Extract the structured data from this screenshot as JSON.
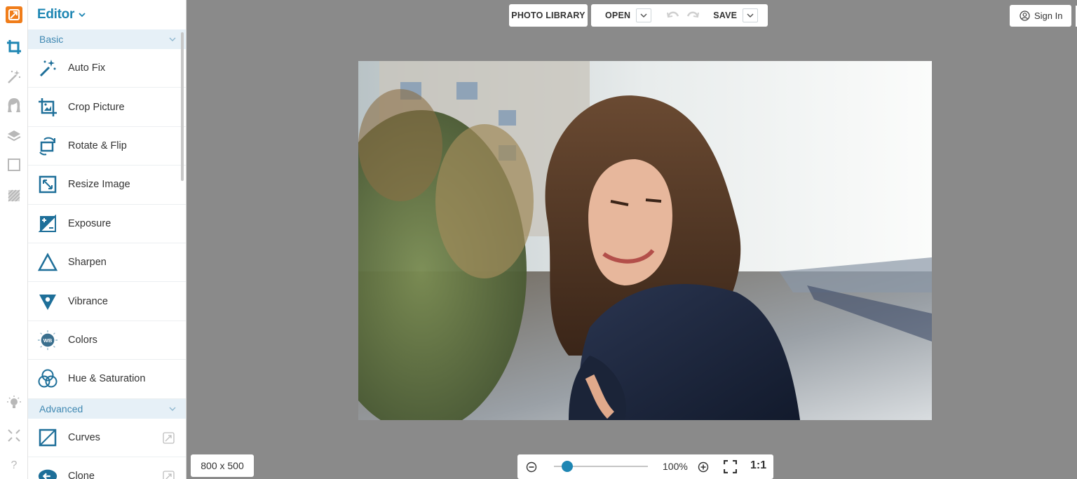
{
  "app": {
    "brand_color": "#f07d1a",
    "accent_color": "#1e86b3"
  },
  "rail": {
    "icons": [
      "crop-icon",
      "magic-wand-icon",
      "portrait-icon",
      "layers-icon",
      "frame-icon",
      "texture-icon",
      "lightbulb-icon",
      "fullscreen-icon",
      "help-icon"
    ],
    "help_label": "?"
  },
  "panel": {
    "title": "Editor",
    "sections": [
      {
        "label": "Basic",
        "tools": [
          {
            "label": "Auto Fix",
            "icon": "auto-fix-icon"
          },
          {
            "label": "Crop Picture",
            "icon": "crop-picture-icon"
          },
          {
            "label": "Rotate & Flip",
            "icon": "rotate-flip-icon"
          },
          {
            "label": "Resize Image",
            "icon": "resize-icon"
          },
          {
            "label": "Exposure",
            "icon": "exposure-icon"
          },
          {
            "label": "Sharpen",
            "icon": "sharpen-icon"
          },
          {
            "label": "Vibrance",
            "icon": "vibrance-icon"
          },
          {
            "label": "Colors",
            "icon": "white-balance-icon",
            "icon_text": "WB"
          },
          {
            "label": "Hue & Saturation",
            "icon": "hue-saturation-icon"
          }
        ]
      },
      {
        "label": "Advanced",
        "tools": [
          {
            "label": "Curves",
            "icon": "curves-icon",
            "pro": true
          },
          {
            "label": "Clone",
            "icon": "clone-icon",
            "pro": true
          }
        ]
      }
    ]
  },
  "topbar": {
    "photo_library": "PHOTO LIBRARY",
    "open": "OPEN",
    "save": "SAVE",
    "sign_in": "Sign In"
  },
  "canvas": {
    "image_size": "800 x 500",
    "zoom": "100%",
    "actual_size": "1:1",
    "zoom_level": 0.14
  }
}
